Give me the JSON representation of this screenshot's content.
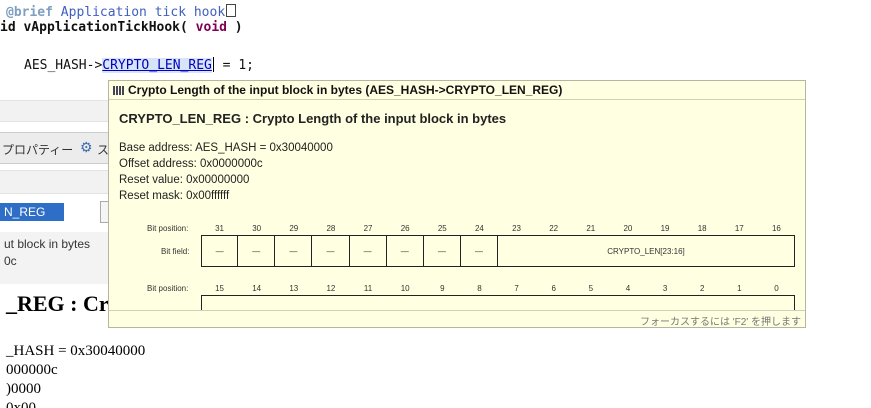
{
  "editor": {
    "comment_tag": "@brief",
    "comment_text": " Application tick hook",
    "func_prefix": "id vApplicationTickHook( ",
    "func_void": "void",
    "func_suffix": " )",
    "stmt_object": "AES_HASH->",
    "stmt_member": "CRYPTO_LEN_REG",
    "stmt_rest": " = 1;"
  },
  "background": {
    "props_tab_label": "プロパティー",
    "props_tab_partial": "ス",
    "filter_value": "N_REG",
    "desc_line1": "ut block in bytes",
    "desc_line2": "0c",
    "heading_partial": "_REG : Cr",
    "addr_line1": "_HASH = 0x30040000",
    "addr_line2": "000000c",
    "addr_line3": ")0000"
  },
  "popup": {
    "title": "Crypto Length of the input block in bytes (AES_HASH->CRYPTO_LEN_REG)",
    "heading": "CRYPTO_LEN_REG : Crypto Length of the input block in bytes",
    "base_address": "Base address: AES_HASH = 0x30040000",
    "offset_address": "Offset address: 0x0000000c",
    "reset_value": "Reset value: 0x00000000",
    "reset_mask": "Reset mask: 0x00ffffff",
    "bit_position_label": "Bit position:",
    "bit_field_label": "Bit field:",
    "row1_bits": [
      "31",
      "30",
      "29",
      "28",
      "27",
      "26",
      "25",
      "24",
      "23",
      "22",
      "21",
      "20",
      "19",
      "18",
      "17",
      "16"
    ],
    "row1_fields": [
      "—",
      "—",
      "—",
      "—",
      "—",
      "—",
      "—",
      "—",
      "CRYPTO_LEN[23:16]"
    ],
    "row2_bits": [
      "15",
      "14",
      "13",
      "12",
      "11",
      "10",
      "9",
      "8",
      "7",
      "6",
      "5",
      "4",
      "3",
      "2",
      "1",
      "0"
    ],
    "footer_hint": "フォーカスするには 'F2' を押します"
  },
  "icons": {
    "popup_title_icon": "register-icon",
    "props_tab_icon": "gear-plugin-icon"
  }
}
